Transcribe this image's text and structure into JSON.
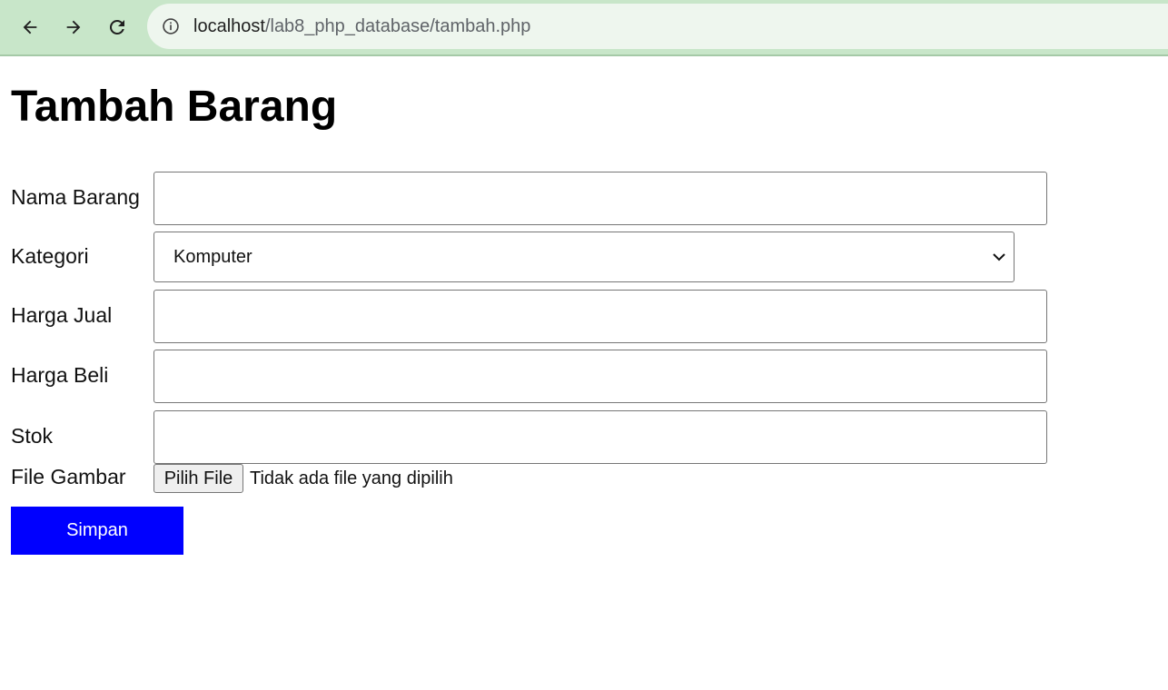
{
  "browser": {
    "back_icon": "arrow-left-icon",
    "forward_icon": "arrow-right-icon",
    "reload_icon": "reload-icon",
    "site_info_icon": "info-icon",
    "url_host": "localhost",
    "url_path": "/lab8_php_database/tambah.php"
  },
  "page": {
    "title": "Tambah Barang"
  },
  "form": {
    "nama_barang": {
      "label": "Nama Barang",
      "value": ""
    },
    "kategori": {
      "label": "Kategori",
      "selected": "Komputer"
    },
    "harga_jual": {
      "label": "Harga Jual",
      "value": ""
    },
    "harga_beli": {
      "label": "Harga Beli",
      "value": ""
    },
    "stok": {
      "label": "Stok",
      "value": ""
    },
    "file_gambar": {
      "label": "File Gambar",
      "button_label": "Pilih File",
      "status": "Tidak ada file yang dipilih"
    },
    "submit_label": "Simpan"
  },
  "colors": {
    "toolbar": "#c8e6c9",
    "omnibox": "#eef6ee",
    "submit_button": "#0000ff"
  }
}
